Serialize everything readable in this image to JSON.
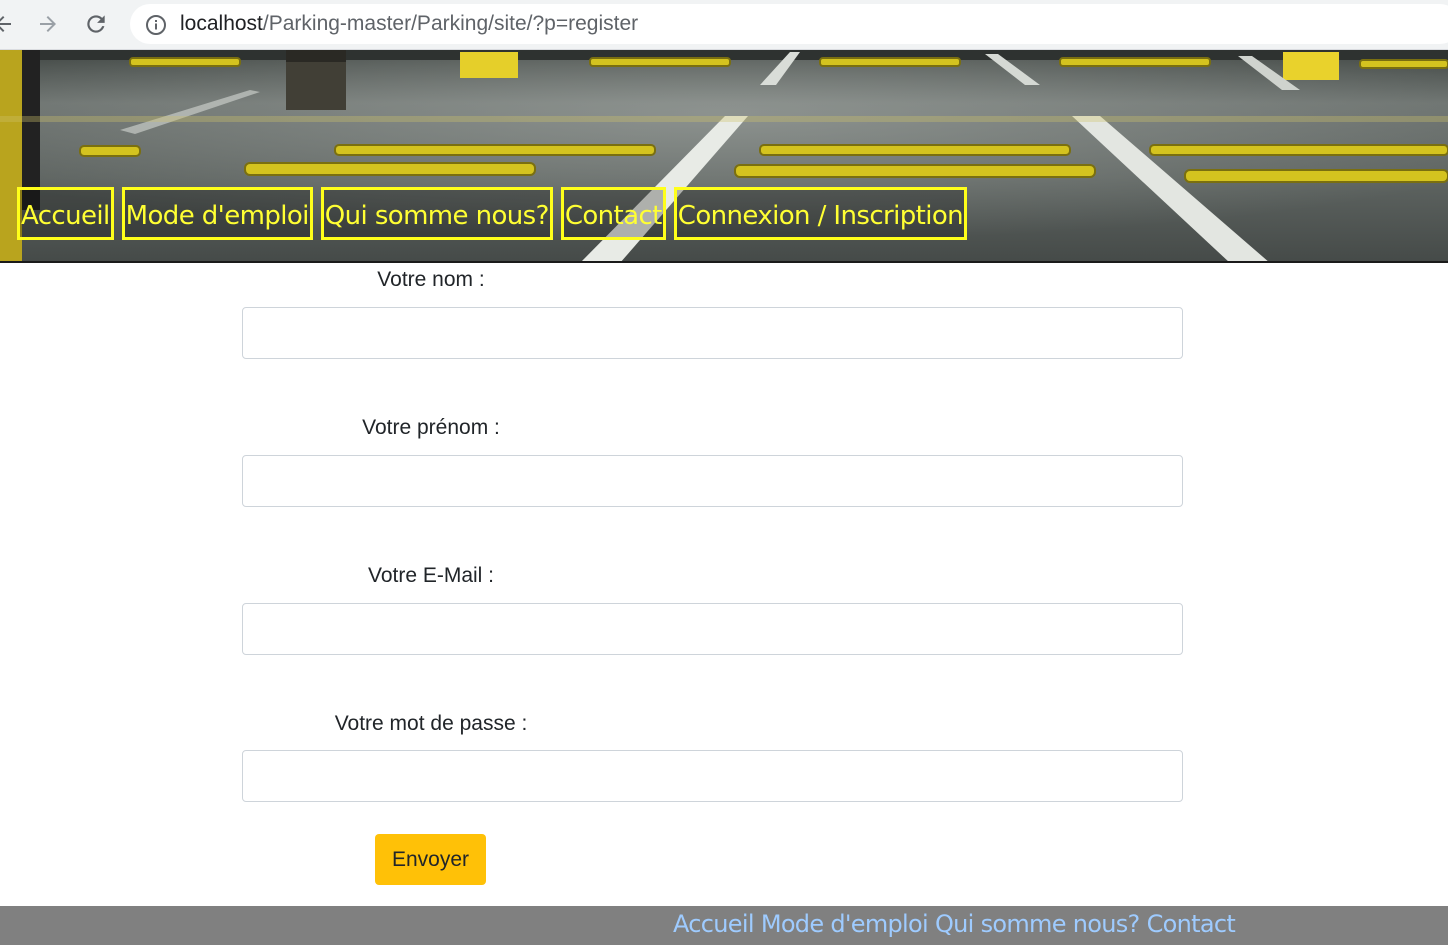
{
  "browser": {
    "url_host": "localhost",
    "url_path": "/Parking-master/Parking/site/?p=register"
  },
  "nav": {
    "items": [
      {
        "label": "Accueil"
      },
      {
        "label": "Mode d'emploi"
      },
      {
        "label": "Qui somme nous?"
      },
      {
        "label": "Contact"
      },
      {
        "label": "Connexion / Inscription"
      }
    ],
    "color": "#ffff33"
  },
  "form": {
    "nom_label": "Votre nom :",
    "prenom_label": "Votre prénom :",
    "email_label": "Votre E-Mail :",
    "password_label": "Votre mot de passe :",
    "nom_value": "",
    "prenom_value": "",
    "email_value": "",
    "password_value": "",
    "submit_label": "Envoyer",
    "submit_color": "#ffc107"
  },
  "footer": {
    "links": [
      {
        "label": "Accueil"
      },
      {
        "label": "Mode d'emploi"
      },
      {
        "label": "Qui somme nous?"
      },
      {
        "label": "Contact"
      }
    ],
    "background": "#808080",
    "link_color": "#9ecbff"
  }
}
